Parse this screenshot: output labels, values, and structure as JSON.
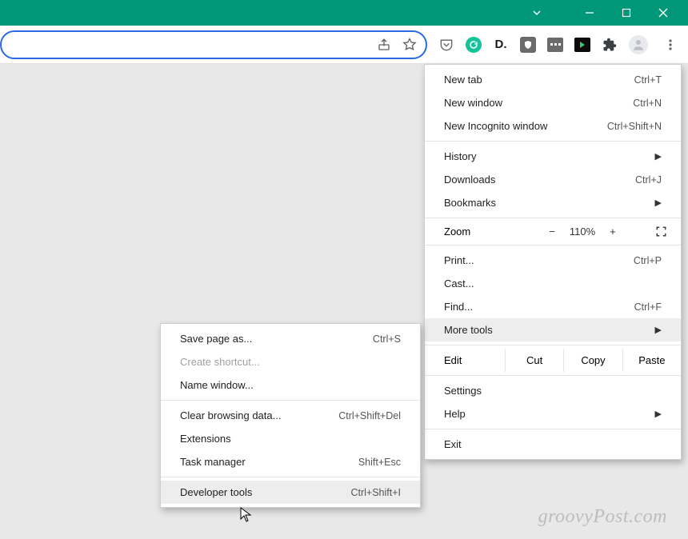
{
  "toolbar": {
    "extensions": [
      "pocket",
      "grammarly",
      "dark",
      "ublock",
      "dash",
      "player",
      "puzzle"
    ]
  },
  "menu": {
    "new_tab": {
      "label": "New tab",
      "shortcut": "Ctrl+T"
    },
    "new_window": {
      "label": "New window",
      "shortcut": "Ctrl+N"
    },
    "new_incognito": {
      "label": "New Incognito window",
      "shortcut": "Ctrl+Shift+N"
    },
    "history": {
      "label": "History"
    },
    "downloads": {
      "label": "Downloads",
      "shortcut": "Ctrl+J"
    },
    "bookmarks": {
      "label": "Bookmarks"
    },
    "zoom": {
      "label": "Zoom",
      "minus": "−",
      "value": "110%",
      "plus": "+"
    },
    "print": {
      "label": "Print...",
      "shortcut": "Ctrl+P"
    },
    "cast": {
      "label": "Cast..."
    },
    "find": {
      "label": "Find...",
      "shortcut": "Ctrl+F"
    },
    "more_tools": {
      "label": "More tools"
    },
    "edit": {
      "label": "Edit",
      "cut": "Cut",
      "copy": "Copy",
      "paste": "Paste"
    },
    "settings": {
      "label": "Settings"
    },
    "help": {
      "label": "Help"
    },
    "exit": {
      "label": "Exit"
    }
  },
  "submenu": {
    "save_page": {
      "label": "Save page as...",
      "shortcut": "Ctrl+S"
    },
    "create_shortcut": {
      "label": "Create shortcut..."
    },
    "name_window": {
      "label": "Name window..."
    },
    "clear_data": {
      "label": "Clear browsing data...",
      "shortcut": "Ctrl+Shift+Del"
    },
    "extensions": {
      "label": "Extensions"
    },
    "task_manager": {
      "label": "Task manager",
      "shortcut": "Shift+Esc"
    },
    "dev_tools": {
      "label": "Developer tools",
      "shortcut": "Ctrl+Shift+I"
    }
  },
  "watermark": "groovyPost.com"
}
